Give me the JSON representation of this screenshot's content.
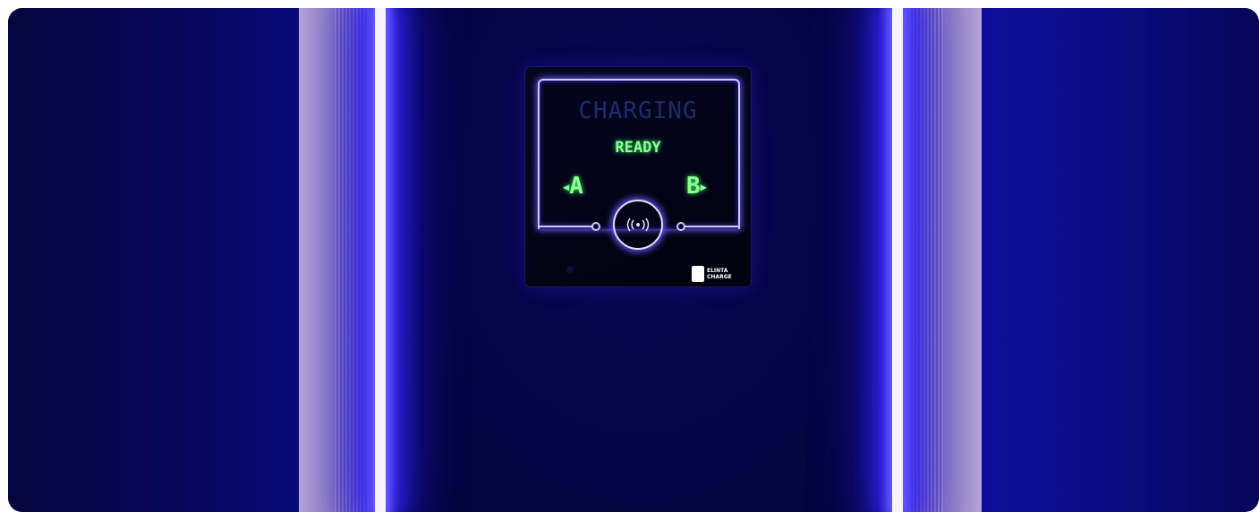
{
  "screen": {
    "title": "CHARGING",
    "status": "READY",
    "port_left": "A",
    "port_right": "B"
  },
  "logo": {
    "line1": "ELINTA",
    "line2": "CHARGE"
  },
  "icons": [
    "rfid-contactless-icon",
    "led-indicator",
    "elinta-logo"
  ],
  "colors": {
    "ambient_blue": "#0a0a70",
    "pillar_light": "#f5f3ff",
    "display_green": "#8dff9a",
    "inactive_text": "#1e2a6e"
  }
}
